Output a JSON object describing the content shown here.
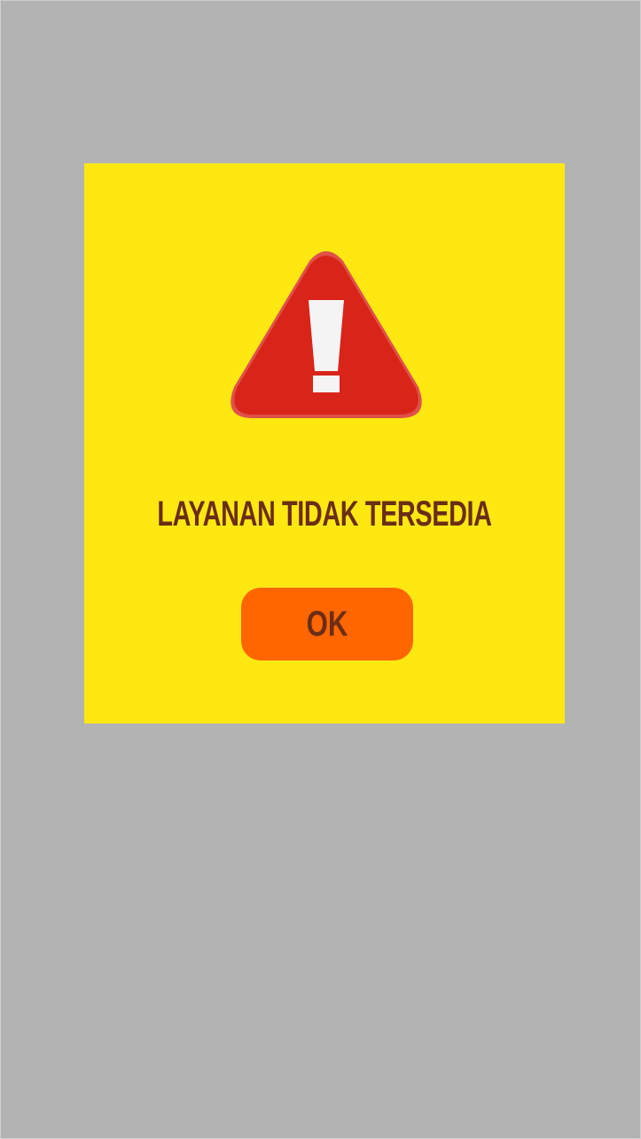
{
  "dialog": {
    "background_color": "#ffe812",
    "icon": "warning-triangle-icon",
    "icon_color": "#d9241a",
    "message": "LAYANAN TIDAK TERSEDIA",
    "message_color": "#6b2d16",
    "ok_button": {
      "label": "OK",
      "color": "#ff6600"
    }
  },
  "backdrop_color": "#b3b3b3"
}
